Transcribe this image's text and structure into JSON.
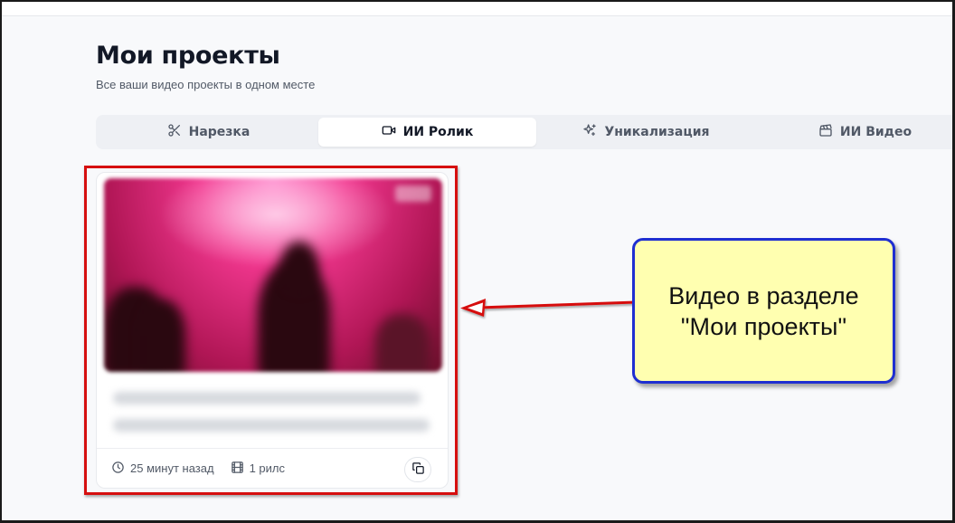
{
  "header": {
    "title": "Мои проекты",
    "subtitle": "Все ваши видео проекты в одном месте"
  },
  "tabs": [
    {
      "label": "Нарезка",
      "icon": "scissors-icon",
      "active": false
    },
    {
      "label": "ИИ Ролик",
      "icon": "video-camera-icon",
      "active": true
    },
    {
      "label": "Уникализация",
      "icon": "sparkles-icon",
      "active": false
    },
    {
      "label": "ИИ Видео",
      "icon": "clapperboard-icon",
      "active": false
    }
  ],
  "project_card": {
    "time_ago": "25 минут назад",
    "reels_count": "1 рилс",
    "time_icon": "clock-icon",
    "reels_icon": "film-icon",
    "action_icon": "copy-icon"
  },
  "annotation": {
    "callout_line1": "Видео в разделе",
    "callout_line2": "\"Мои проекты\"",
    "box_color": "#d60f0f",
    "callout_border_color": "#1f2fd1",
    "callout_bg_color": "#ffffb0"
  }
}
